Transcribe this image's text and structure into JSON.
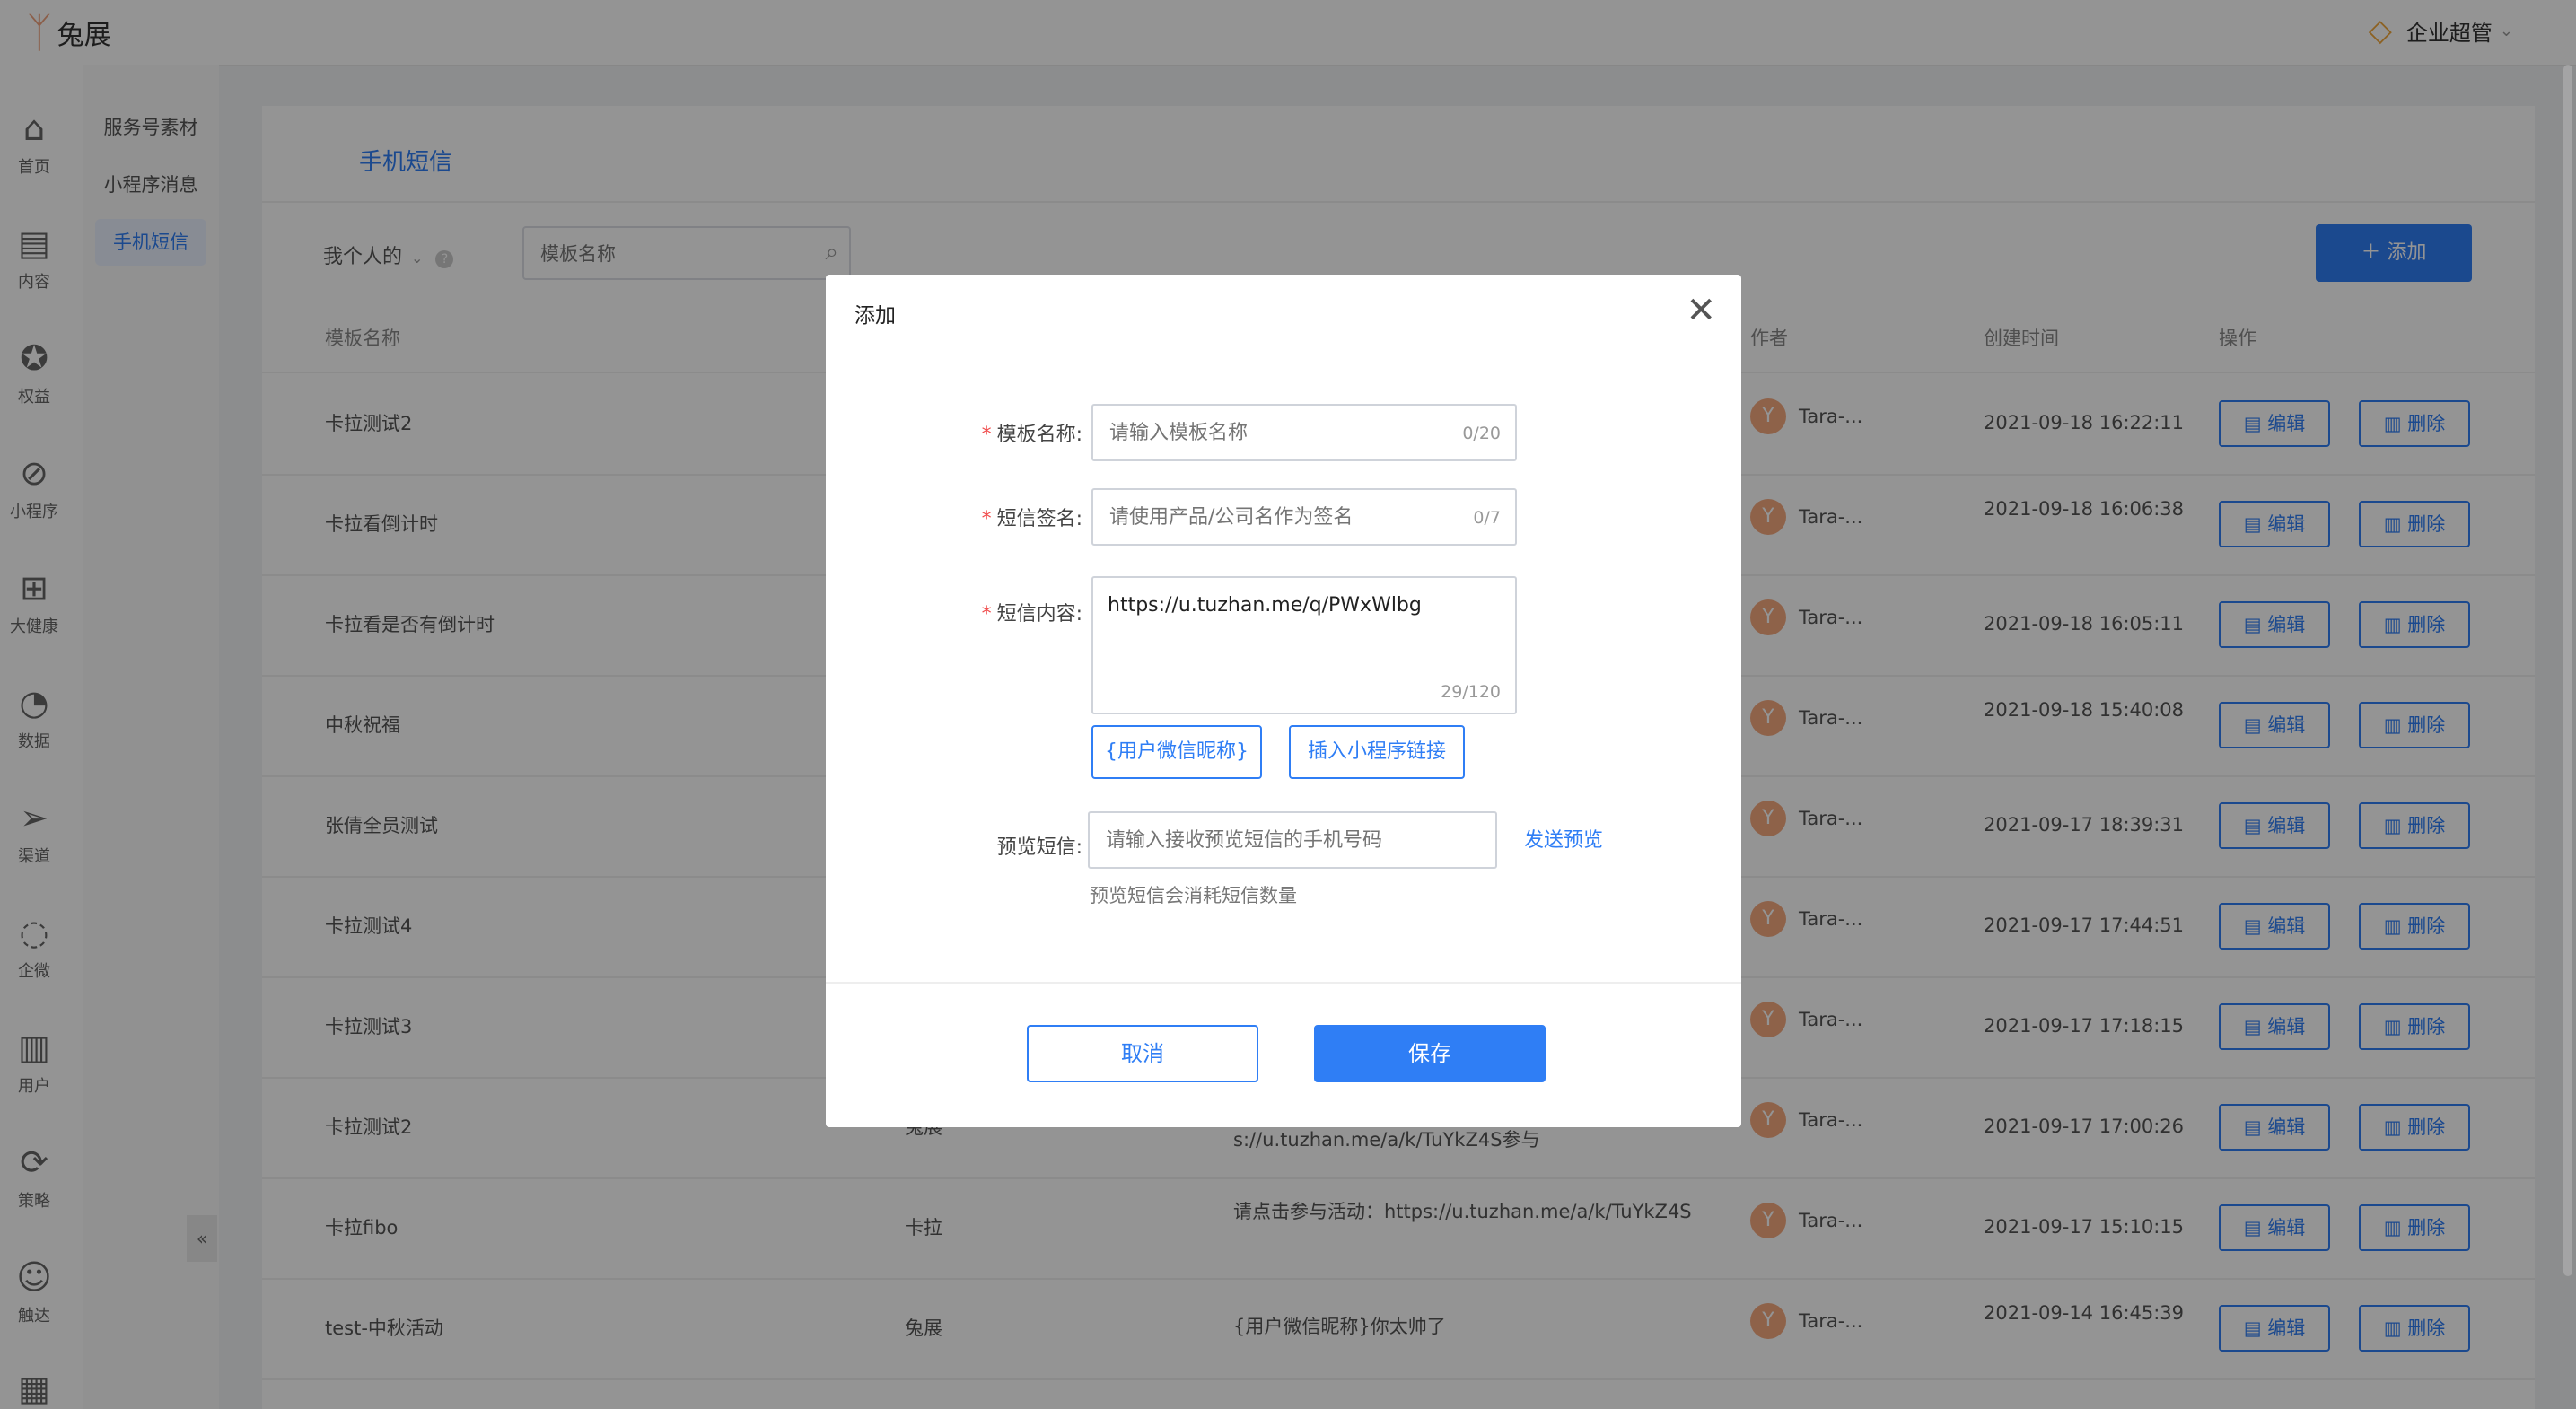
{
  "app": {
    "logo_text": "兔展",
    "user_label": "企业超管"
  },
  "leftnav": [
    {
      "label": "首页",
      "icon": "home-icon"
    },
    {
      "label": "内容",
      "icon": "document-icon"
    },
    {
      "label": "权益",
      "icon": "medal-icon"
    },
    {
      "label": "小程序",
      "icon": "miniprogram-icon"
    },
    {
      "label": "大健康",
      "icon": "health-icon"
    },
    {
      "label": "数据",
      "icon": "pie-chart-icon"
    },
    {
      "label": "渠道",
      "icon": "send-icon"
    },
    {
      "label": "企微",
      "icon": "chat-icon"
    },
    {
      "label": "用户",
      "icon": "user-list-icon"
    },
    {
      "label": "策略",
      "icon": "strategy-icon"
    },
    {
      "label": "触达",
      "icon": "reach-icon"
    }
  ],
  "subnav": [
    {
      "label": "服务号素材"
    },
    {
      "label": "小程序消息"
    },
    {
      "label": "手机短信",
      "active": true
    }
  ],
  "main": {
    "tab": "手机短信",
    "filter_label": "我个人的",
    "search_placeholder": "模板名称",
    "add_label": "＋ 添加",
    "columns": [
      "模板名称",
      "作者",
      "创建时间",
      "操作"
    ],
    "edit_label": "编辑",
    "delete_label": "删除",
    "rows": [
      {
        "name": "卡拉测试2",
        "signature": "",
        "content": "",
        "author": "Tara-...",
        "time": "2021-09-18 16:22:11"
      },
      {
        "name": "卡拉看倒计时",
        "signature": "",
        "content": "",
        "author": "Tara-...",
        "time": "2021-09-18 16:06:38"
      },
      {
        "name": "卡拉看是否有倒计时",
        "signature": "",
        "content": "",
        "author": "Tara-...",
        "time": "2021-09-18 16:05:11"
      },
      {
        "name": "中秋祝福",
        "signature": "",
        "content": "",
        "author": "Tara-...",
        "time": "2021-09-18 15:40:08"
      },
      {
        "name": "张倩全员测试",
        "signature": "",
        "content": "",
        "author": "Tara-...",
        "time": "2021-09-17 18:39:31"
      },
      {
        "name": "卡拉测试4",
        "signature": "",
        "content": "",
        "author": "Tara-...",
        "time": "2021-09-17 17:44:51"
      },
      {
        "name": "卡拉测试3",
        "signature": "",
        "content": "",
        "author": "Tara-...",
        "time": "2021-09-17 17:18:15"
      },
      {
        "name": "卡拉测试2",
        "signature": "兔展",
        "content": "s://u.tuzhan.me/a/k/TuYkZ4S参与",
        "author": "Tara-...",
        "time": "2021-09-17 17:00:26"
      },
      {
        "name": "卡拉fibo",
        "signature": "卡拉",
        "content": "请点击参与活动：https://u.tuzhan.me/a/k/TuYkZ4S",
        "author": "Tara-...",
        "time": "2021-09-17 15:10:15"
      },
      {
        "name": "test-中秋活动",
        "signature": "兔展",
        "content": "{用户微信昵称}你太帅了",
        "author": "Tara-...",
        "time": "2021-09-14 16:45:39"
      }
    ]
  },
  "modal": {
    "title": "添加",
    "template_name_label": "模板名称:",
    "template_name_placeholder": "请输入模板名称",
    "template_name_count": "0/20",
    "signature_label": "短信签名:",
    "signature_placeholder": "请使用产品/公司名作为签名",
    "signature_count": "0/7",
    "content_label": "短信内容:",
    "content_value": "https://u.tuzhan.me/q/PWxWlbg",
    "content_count": "29/120",
    "insert_nickname": "{用户微信昵称}",
    "insert_link": "插入小程序链接",
    "preview_label": "预览短信:",
    "preview_placeholder": "请输入接收预览短信的手机号码",
    "send_preview": "发送预览",
    "preview_hint": "预览短信会消耗短信数量",
    "cancel": "取消",
    "save": "保存"
  }
}
